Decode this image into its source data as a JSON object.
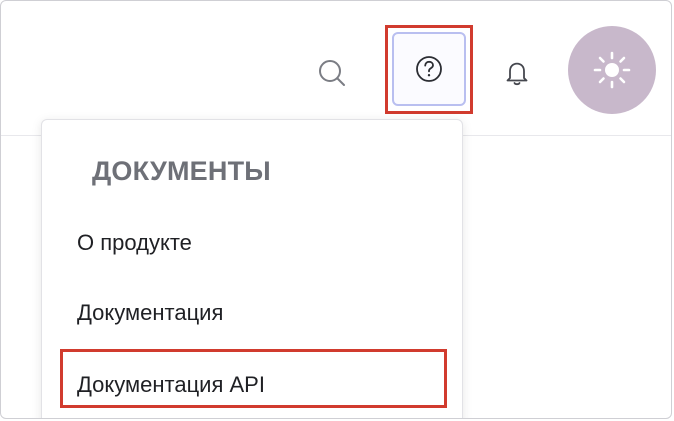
{
  "header": {
    "search_icon": "search-icon",
    "help_icon": "help-icon",
    "bell_icon": "bell-icon",
    "avatar_icon": "sun-icon"
  },
  "dropdown": {
    "heading": "ДОКУМЕНТЫ",
    "items": [
      {
        "label": "О продукте"
      },
      {
        "label": "Документация"
      },
      {
        "label": "Документация API"
      }
    ]
  },
  "colors": {
    "highlight": "#d13b2e",
    "avatar": "#c8b8cb",
    "help_border": "#b9bff0",
    "heading_text": "#6e7077"
  }
}
